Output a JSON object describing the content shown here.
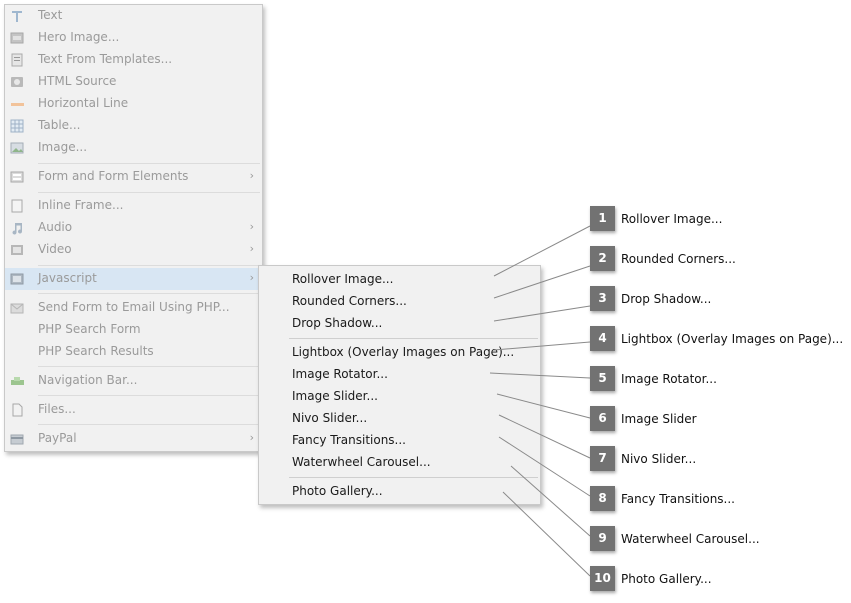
{
  "main_menu": {
    "items": [
      {
        "label": "Text",
        "icon": "text-icon",
        "arrow": false
      },
      {
        "label": "Hero Image...",
        "icon": "hero-image-icon",
        "arrow": false
      },
      {
        "label": "Text From Templates...",
        "icon": "template-icon",
        "arrow": false
      },
      {
        "label": "HTML Source",
        "icon": "html-source-icon",
        "arrow": false
      },
      {
        "label": "Horizontal Line",
        "icon": "horizontal-line-icon",
        "arrow": false
      },
      {
        "label": "Table...",
        "icon": "table-icon",
        "arrow": false
      },
      {
        "label": "Image...",
        "icon": "image-icon",
        "arrow": false
      },
      {
        "label": "Form and Form Elements",
        "icon": "form-icon",
        "arrow": true
      },
      {
        "label": "Inline Frame...",
        "icon": "frame-icon",
        "arrow": false
      },
      {
        "label": "Audio",
        "icon": "audio-icon",
        "arrow": true
      },
      {
        "label": "Video",
        "icon": "video-icon",
        "arrow": true
      },
      {
        "label": "Javascript",
        "icon": "javascript-icon",
        "arrow": true
      },
      {
        "label": "Send Form to Email Using PHP...",
        "icon": "php-email-icon",
        "arrow": false
      },
      {
        "label": "PHP Search Form",
        "icon": "",
        "arrow": false
      },
      {
        "label": "PHP Search Results",
        "icon": "",
        "arrow": false
      },
      {
        "label": "Navigation Bar...",
        "icon": "navigation-bar-icon",
        "arrow": false
      },
      {
        "label": "Files...",
        "icon": "files-icon",
        "arrow": false
      },
      {
        "label": "PayPal",
        "icon": "paypal-icon",
        "arrow": true
      }
    ]
  },
  "submenu": {
    "items": [
      "Rollover Image...",
      "Rounded Corners...",
      "Drop Shadow...",
      "Lightbox (Overlay Images on Page)...",
      "Image Rotator...",
      "Image Slider...",
      "Nivo Slider...",
      "Fancy Transitions...",
      "Waterwheel Carousel...",
      "Photo Gallery..."
    ]
  },
  "callouts": [
    {
      "number": "1",
      "label": "Rollover Image..."
    },
    {
      "number": "2",
      "label": "Rounded Corners..."
    },
    {
      "number": "3",
      "label": "Drop Shadow..."
    },
    {
      "number": "4",
      "label": "Lightbox (Overlay Images on Page)..."
    },
    {
      "number": "5",
      "label": "Image Rotator..."
    },
    {
      "number": "6",
      "label": "Image Slider"
    },
    {
      "number": "7",
      "label": "Nivo Slider..."
    },
    {
      "number": "8",
      "label": "Fancy Transitions..."
    },
    {
      "number": "9",
      "label": "Waterwheel Carousel..."
    },
    {
      "number": "10",
      "label": "Photo Gallery..."
    }
  ],
  "colors": {
    "menu_bg": "#f1f1f1",
    "highlight": "#d8e6f3",
    "disabled_text": "#9a9a9a",
    "badge": "#727272"
  },
  "arrow_glyph": "›"
}
